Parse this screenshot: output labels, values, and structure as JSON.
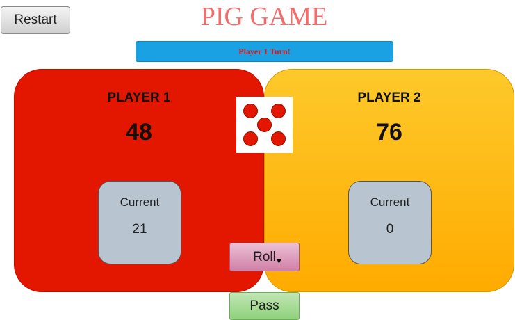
{
  "restart_label": "Restart",
  "title": "PIG GAME",
  "turn_message": "Player 1 Turn!",
  "players": [
    {
      "name": "PLAYER 1",
      "score": "48",
      "current_label": "Current",
      "current_value": "21",
      "color": "#e31600"
    },
    {
      "name": "PLAYER 2",
      "score": "76",
      "current_label": "Current",
      "current_value": "0",
      "color": "#ffb300"
    }
  ],
  "die": {
    "face": 5,
    "pip_color": "#e31600"
  },
  "roll_label": "Roll",
  "pass_label": "Pass"
}
